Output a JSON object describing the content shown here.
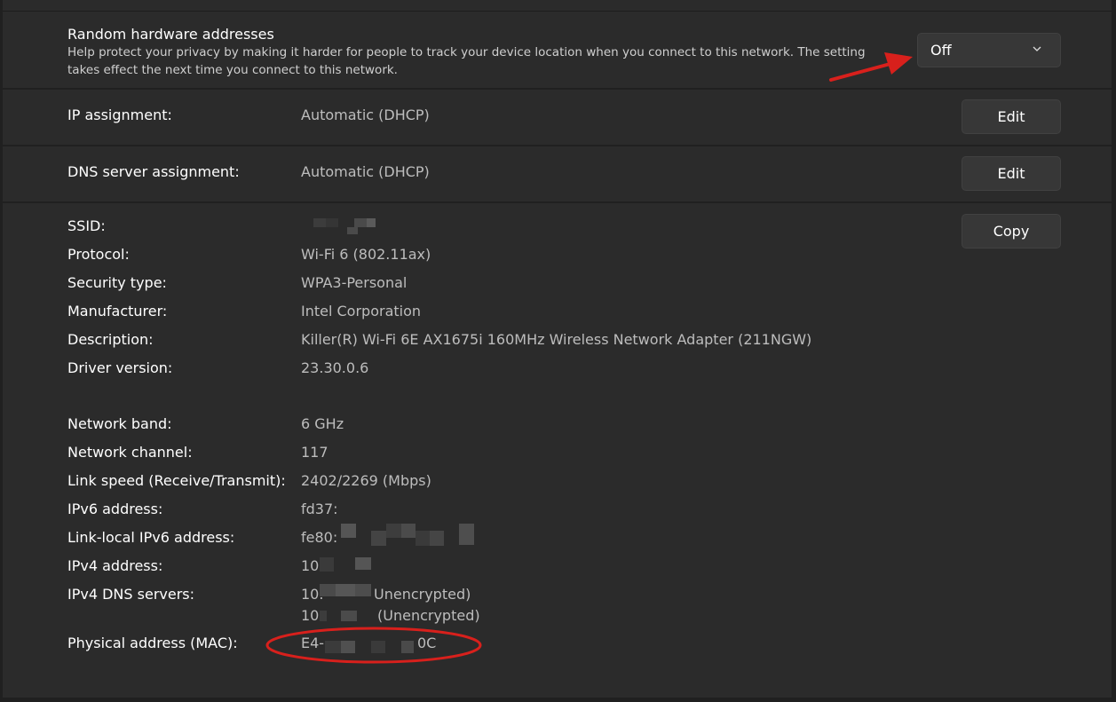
{
  "random_hw": {
    "title": "Random hardware addresses",
    "desc_line1": "Help protect your privacy by making it harder for people to track your device location when you connect to this network. The setting",
    "desc_line2": "takes effect the next time you connect to this network.",
    "value": "Off"
  },
  "ip_assignment": {
    "label": "IP assignment:",
    "value": "Automatic (DHCP)",
    "button": "Edit"
  },
  "dns_assignment": {
    "label": "DNS server assignment:",
    "value": "Automatic (DHCP)",
    "button": "Edit"
  },
  "props": {
    "copy_button": "Copy",
    "ssid_label": "SSID:",
    "protocol_label": "Protocol:",
    "protocol": "Wi-Fi 6 (802.11ax)",
    "security_label": "Security type:",
    "security": "WPA3-Personal",
    "manufacturer_label": "Manufacturer:",
    "manufacturer": "Intel Corporation",
    "description_label": "Description:",
    "description": "Killer(R) Wi-Fi 6E AX1675i 160MHz Wireless Network Adapter (211NGW)",
    "driver_label": "Driver version:",
    "driver": "23.30.0.6",
    "band_label": "Network band:",
    "band": "6 GHz",
    "channel_label": "Network channel:",
    "channel": "117",
    "link_speed_label": "Link speed (Receive/Transmit):",
    "link_speed": "2402/2269 (Mbps)",
    "ipv6_label": "IPv6 address:",
    "ipv6": "fd37:",
    "link_local_label": "Link-local IPv6 address:",
    "link_local": "fe80:",
    "ipv4_label": "IPv4 address:",
    "ipv4": "10.",
    "ipv4_dns_label": "IPv4 DNS servers:",
    "dns1_prefix": "10.",
    "dns1_suffix": "Unencrypted)",
    "dns2_prefix": "10.",
    "dns2_suffix": "(Unencrypted)",
    "mac_label": "Physical address (MAC):",
    "mac_prefix": "E4-",
    "mac_suffix": "0C"
  },
  "colors": {
    "background": "#202020",
    "panel": "#2b2b2b",
    "button": "#373737",
    "annotation_red": "#d8201c"
  },
  "icons": {
    "dropdown": "chevron-down-icon"
  }
}
